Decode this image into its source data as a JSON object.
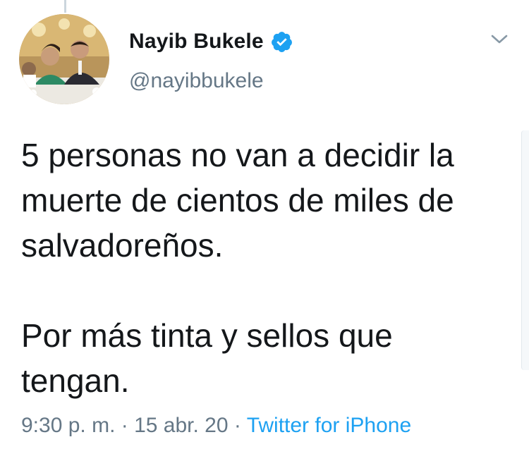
{
  "tweet": {
    "author": {
      "display_name": "Nayib Bukele",
      "handle": "@nayibbukele",
      "verified": true,
      "avatar_icon": "profile-photo"
    },
    "text": "5 personas no van a decidir la\nmuerte de cientos de miles de\nsalvadoreños.\n\nPor más tinta y sellos que\ntengan.",
    "time": "9:30 p. m.",
    "separator": "·",
    "date": "15 abr. 20",
    "source": "Twitter for iPhone"
  },
  "colors": {
    "text": "#14171a",
    "secondary": "#657786",
    "link": "#1da1f2",
    "verified_badge": "#1da1f2"
  },
  "icons": {
    "verified": "verified-badge-icon",
    "menu": "chevron-down-icon"
  }
}
